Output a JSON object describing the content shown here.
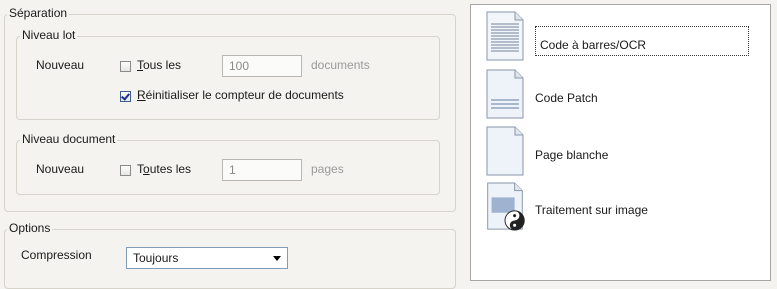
{
  "separation": {
    "legend": "Séparation",
    "batch_level": {
      "legend": "Niveau lot",
      "new_label": "Nouveau",
      "every_checkbox": {
        "label_prefix": "",
        "label_ul": "T",
        "label_rest": "ous les",
        "checked": false
      },
      "count_value": "100",
      "unit": "documents",
      "reset_checkbox": {
        "label_ul": "R",
        "label_rest": "éinitialiser le compteur de documents",
        "checked": true
      }
    },
    "document_level": {
      "legend": "Niveau document",
      "new_label": "Nouveau",
      "every_checkbox": {
        "label_prefix": "T",
        "label_ul": "o",
        "label_rest": "utes les",
        "checked": false
      },
      "count_value": "1",
      "unit": "pages"
    }
  },
  "options": {
    "legend": "Options",
    "compression_label": "Compression",
    "compression_value": "Toujours"
  },
  "separator_list": {
    "items": [
      {
        "label": "Code à barres/OCR",
        "icon": "barcode-ocr-document-icon",
        "selected": true
      },
      {
        "label": "Code Patch",
        "icon": "patch-code-document-icon",
        "selected": false
      },
      {
        "label": "Page blanche",
        "icon": "blank-page-document-icon",
        "selected": false
      },
      {
        "label": "Traitement sur image",
        "icon": "image-processing-document-icon",
        "selected": false
      }
    ]
  },
  "colors": {
    "window_bg": "#f4f3ef",
    "checkmark": "#1f2f8f",
    "select_border": "#7f9db9"
  }
}
